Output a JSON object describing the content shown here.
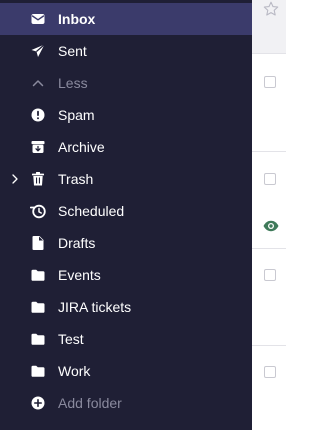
{
  "sidebar": {
    "items": [
      {
        "label": "Inbox",
        "icon": "envelope-icon",
        "active": true
      },
      {
        "label": "Sent",
        "icon": "paper-plane-icon"
      },
      {
        "label": "Less",
        "icon": "chevron-up-icon",
        "muted": true
      },
      {
        "label": "Spam",
        "icon": "exclamation-circle-icon"
      },
      {
        "label": "Archive",
        "icon": "archive-box-icon"
      },
      {
        "label": "Trash",
        "icon": "trash-icon"
      },
      {
        "label": "Scheduled",
        "icon": "scheduled-clock-icon"
      },
      {
        "label": "Drafts",
        "icon": "draft-document-icon"
      },
      {
        "label": "Events",
        "icon": "folder-icon"
      },
      {
        "label": "JIRA tickets",
        "icon": "folder-icon"
      },
      {
        "label": "Test",
        "icon": "folder-icon"
      },
      {
        "label": "Work",
        "icon": "folder-icon"
      },
      {
        "label": "Add folder",
        "icon": "plus-circle-icon",
        "muted": true
      }
    ]
  },
  "colors": {
    "sidebar_bg": "#1f1f35",
    "active_bg": "#3b3b6b",
    "text": "#ffffff",
    "muted_text": "#8a8a9e",
    "eye_icon": "#3f7a5a"
  },
  "message_strip": {
    "row_icons": [
      "star-icon",
      "checkbox",
      "checkbox",
      "eye-icon",
      "checkbox",
      "checkbox"
    ]
  }
}
